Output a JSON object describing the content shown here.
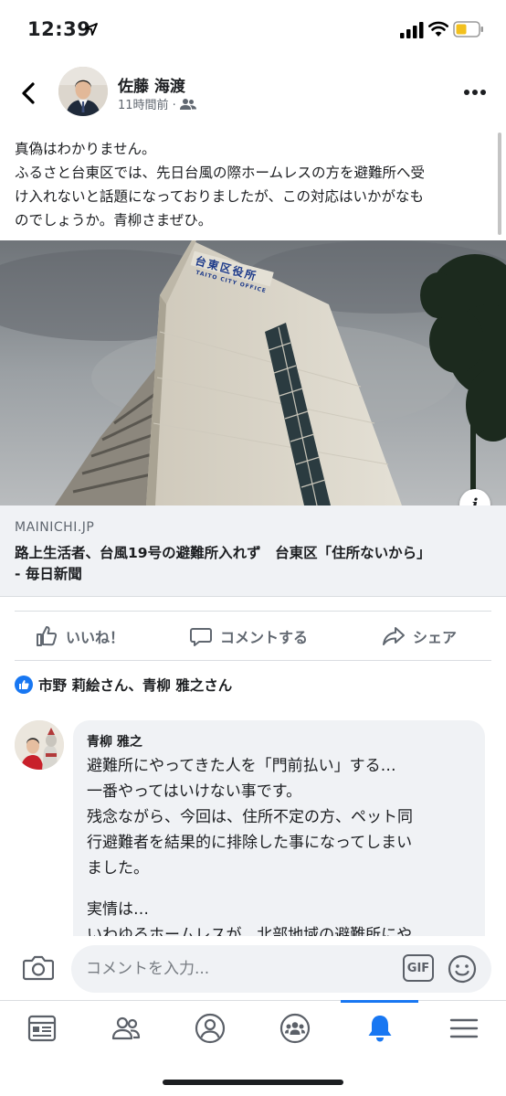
{
  "status_bar": {
    "time": "12:39"
  },
  "post": {
    "author": "佐藤 海渡",
    "time_ago": "11時間前 ·",
    "text_lines": [
      "真偽はわかりません。",
      "ふるさと台東区では、先日台風の際ホームレスの方を避難所へ受",
      "け入れないと話題になっておりましたが、この対応はいかがなも",
      "のでしょうか。青柳さまぜひ。"
    ],
    "link": {
      "image_sign": "台東区役所",
      "image_sign_en": "TAITO CITY OFFICE",
      "info_glyph": "i",
      "domain": "MAINICHI.JP",
      "title_lines": [
        "路上生活者、台風19号の避難所入れず　台東区「住所ないから」",
        "- 毎日新聞"
      ]
    }
  },
  "actions": {
    "like": "いいね！",
    "comment": "コメントする",
    "share": "シェア"
  },
  "reactions": {
    "text": "市野 莉絵さん、青柳 雅之さん"
  },
  "comment": {
    "author": "青柳 雅之",
    "lines": [
      "避難所にやってきた人を「門前払い」する…",
      "一番やってはいけない事です。",
      "残念ながら、今回は、住所不定の方、ペット同",
      "行避難者を結果的に排除した事になってしまい",
      "ました。",
      "",
      "実情は…",
      "いわゆるホームレスが、北部地域の避難所にや"
    ]
  },
  "compose": {
    "placeholder": "コメントを入力...",
    "gif_label": "GIF"
  },
  "colors": {
    "accent": "#1877f2",
    "secondary_text": "#606770",
    "bubble": "#f0f2f5"
  },
  "icons": [
    "location-arrow-icon",
    "signal-icon",
    "wifi-icon",
    "battery-icon",
    "back-chevron-icon",
    "friends-icon",
    "more-icon",
    "info-icon",
    "like-icon",
    "comment-icon",
    "share-icon",
    "camera-icon",
    "gif-icon",
    "emoji-icon",
    "news-feed-icon",
    "friends-tab-icon",
    "profile-icon",
    "groups-icon",
    "bell-icon",
    "menu-icon"
  ]
}
